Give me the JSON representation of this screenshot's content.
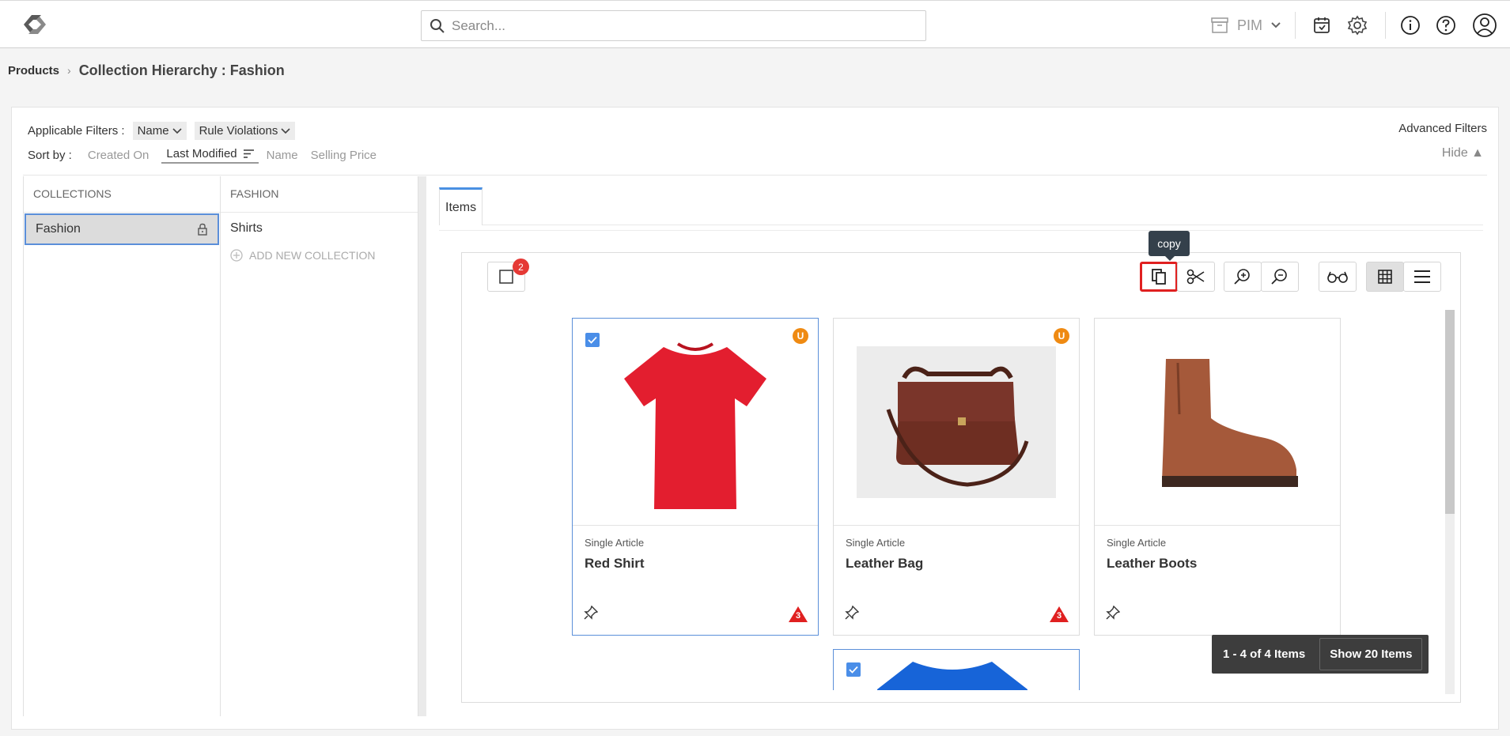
{
  "header": {
    "search_placeholder": "Search...",
    "module_label": "PIM",
    "colors": {
      "accent": "#4a90e2",
      "alert": "#e53935",
      "update": "#ef8a12"
    },
    "icons": [
      "logo-icon",
      "search-icon",
      "archive-icon",
      "chevron-down-icon",
      "store-icon",
      "gear-icon",
      "info-icon",
      "help-icon",
      "user-icon"
    ]
  },
  "breadcrumb": {
    "root": "Products",
    "current": "Collection Hierarchy : Fashion"
  },
  "filters": {
    "label": "Applicable Filters :",
    "chips": [
      "Name",
      "Rule Violations"
    ],
    "advanced": "Advanced Filters",
    "hide": "Hide ▲"
  },
  "sort": {
    "label": "Sort by :",
    "options": [
      "Created On",
      "Last Modified",
      "Name",
      "Selling Price"
    ],
    "active": "Last Modified"
  },
  "collections": {
    "header": "COLLECTIONS",
    "items": [
      "Fashion"
    ]
  },
  "fashion": {
    "header": "FASHION",
    "items": [
      "Shirts"
    ],
    "add_label": "ADD NEW COLLECTION"
  },
  "tabs": {
    "items": "Items"
  },
  "toolbar": {
    "selected_count": "2",
    "tooltip": "copy"
  },
  "cards": [
    {
      "type": "Single Article",
      "name": "Red Shirt",
      "selected": true,
      "badge": "U",
      "warnings": "3"
    },
    {
      "type": "Single Article",
      "name": "Leather Bag",
      "selected": false,
      "badge": "U",
      "warnings": "3"
    },
    {
      "type": "Single Article",
      "name": "Leather Boots",
      "selected": false,
      "badge": "",
      "warnings": ""
    }
  ],
  "pager": {
    "range": "1 - 4 of 4 Items",
    "show": "Show 20 Items"
  }
}
